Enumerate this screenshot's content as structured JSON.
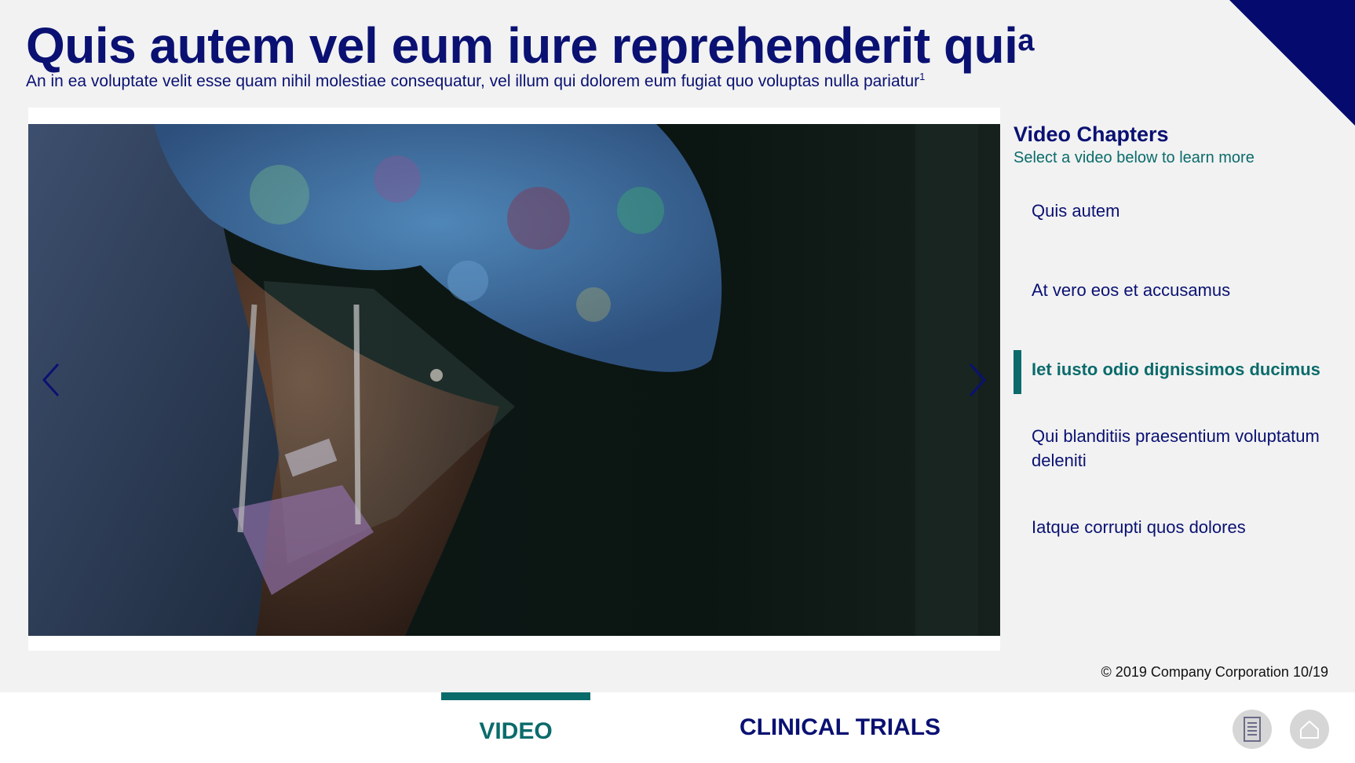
{
  "header": {
    "title": "Quis autem vel eum iure reprehenderit qui",
    "title_sup": "a",
    "subtitle": "An in ea voluptate velit esse quam nihil molestiae consequatur, vel illum qui dolorem eum fugiat quo voluptas nulla pariatur",
    "subtitle_sup": "1"
  },
  "chapters": {
    "title": "Video Chapters",
    "subtitle": "Select a video below to learn more",
    "items": [
      {
        "label": "Quis autem"
      },
      {
        "label": "At vero eos et accusamus"
      },
      {
        "label": "Iet iusto odio dignissimos ducimus",
        "active": true
      },
      {
        "label": "Qui blanditiis praesentium voluptatum deleniti"
      },
      {
        "label": "Iatque corrupti quos dolores"
      }
    ]
  },
  "footer": {
    "copyright": "© 2019 Company Corporation 10/19"
  },
  "tabs": [
    {
      "label": "VIDEO",
      "active": true
    },
    {
      "label": "CLINICAL TRIALS",
      "active": false
    }
  ],
  "icons": {
    "prev": "chevron-left-icon",
    "next": "chevron-right-icon",
    "document": "document-icon",
    "home": "home-icon"
  },
  "colors": {
    "navy": "#0a1172",
    "teal": "#0b6b6b",
    "corner": "#050a6e",
    "background": "#f2f2f2"
  }
}
